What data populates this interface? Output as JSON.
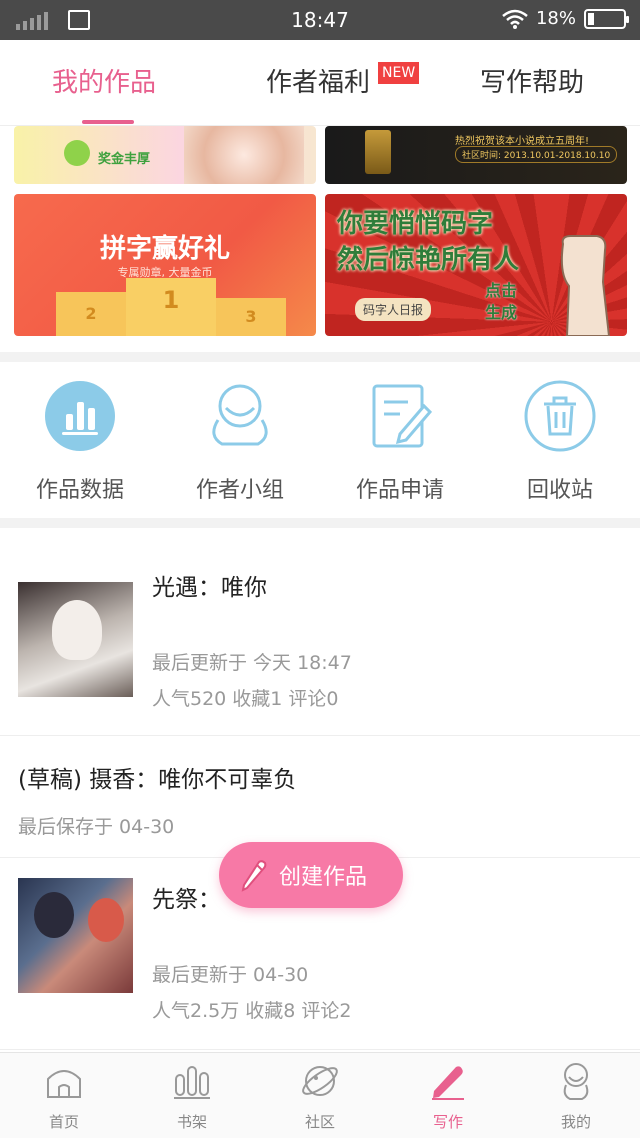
{
  "status_bar": {
    "time": "18:47",
    "battery": "18%"
  },
  "top_tabs": [
    {
      "label": "我的作品",
      "active": true
    },
    {
      "label": "作者福利",
      "active": false,
      "badge": "NEW"
    },
    {
      "label": "写作帮助",
      "active": false
    }
  ],
  "banners": {
    "top_left_tag": "奖金丰厚",
    "top_right_text": "热烈祝贺该本小说成立五周年!",
    "top_right_date": "社区时间: 2013.10.01-2018.10.10",
    "left_title": "拼字赢好礼",
    "left_subtitle": "专属勋章, 大量金币",
    "podium": [
      "2",
      "1",
      "3"
    ],
    "right_title_line1": "你要悄悄码字",
    "right_title_line2": "然后惊艳所有人",
    "right_tag": "码字人日报",
    "right_cta_line1": "点击",
    "right_cta_line2": "生成"
  },
  "actions": [
    {
      "label": "作品数据",
      "icon": "bar-chart-icon"
    },
    {
      "label": "作者小组",
      "icon": "group-icon"
    },
    {
      "label": "作品申请",
      "icon": "edit-document-icon"
    },
    {
      "label": "回收站",
      "icon": "trash-icon"
    }
  ],
  "works": [
    {
      "title": "光遇：唯你",
      "updated": "最后更新于 今天 18:47",
      "stats": "人气520  收藏1  评论0"
    },
    {
      "title": "(草稿) 摄香：唯你不可辜负",
      "updated": "最后保存于 04-30"
    },
    {
      "title": "先祭：",
      "updated": "最后更新于 04-30",
      "stats": "人气2.5万  收藏8  评论2"
    }
  ],
  "fab": {
    "label": "创建作品"
  },
  "bottom_nav": [
    {
      "label": "首页",
      "active": false
    },
    {
      "label": "书架",
      "active": false
    },
    {
      "label": "社区",
      "active": false
    },
    {
      "label": "写作",
      "active": true
    },
    {
      "label": "我的",
      "active": false
    }
  ],
  "colors": {
    "accent": "#e8608e",
    "icon_blue": "#8ccbe8",
    "fab": "#f779a6"
  }
}
